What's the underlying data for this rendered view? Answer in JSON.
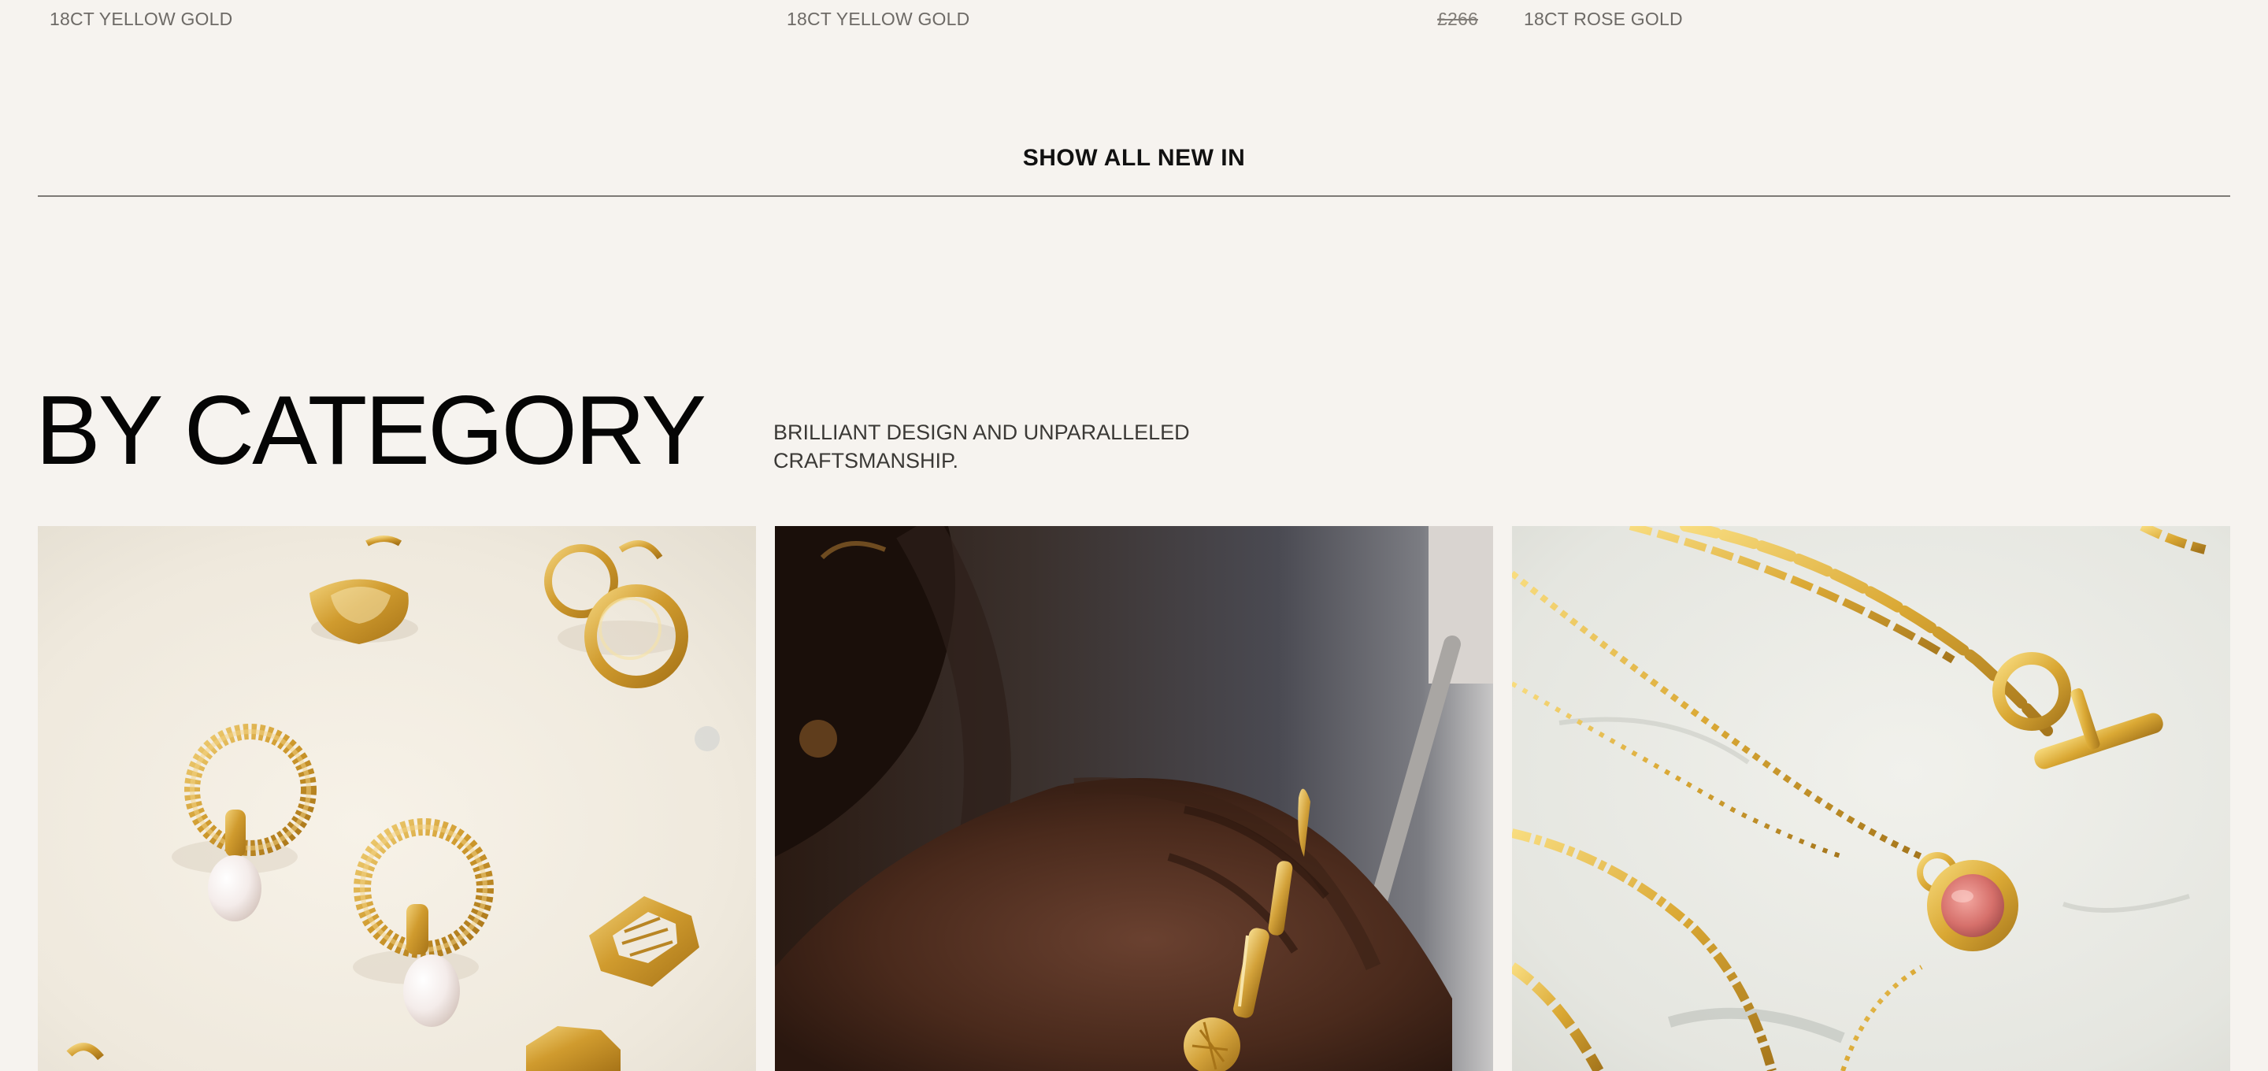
{
  "product_meta": [
    {
      "material": "18CT YELLOW GOLD"
    },
    {
      "material": "18CT YELLOW GOLD"
    },
    {
      "price": "£266",
      "material": "18CT ROSE GOLD"
    }
  ],
  "show_all": {
    "label": "SHOW ALL NEW IN"
  },
  "category_section": {
    "title": "BY CATEGORY",
    "subtitle": "BRILLIANT DESIGN AND UNPARALLELED CRAFTSMANSHIP."
  },
  "tiles": [
    {
      "image": "earrings-photo"
    },
    {
      "image": "rings-photo"
    },
    {
      "image": "necklaces-photo"
    }
  ],
  "colors": {
    "background": "#f6f3ef",
    "text": "#111111",
    "muted_text": "#6d6a66",
    "divider": "#7d7a76",
    "gold": "#d5a437"
  }
}
